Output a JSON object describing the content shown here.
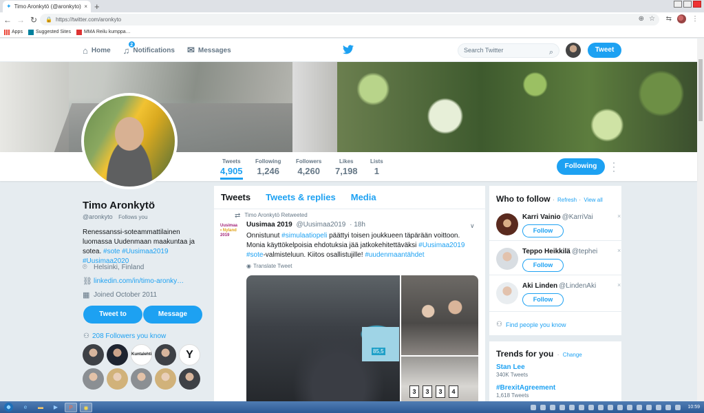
{
  "browser": {
    "tab_title": "Timo Aronkytö (@aronkyto) | Tw…",
    "tab_close": "×",
    "new_tab": "+",
    "url": "https://twitter.com/aronkyto",
    "bookmarks": [
      "Apps",
      "Suggested Sites",
      "MMA Reilu kumppa…"
    ]
  },
  "header": {
    "nav": [
      {
        "label": "Home",
        "icon": "home-icon"
      },
      {
        "label": "Notifications",
        "icon": "bell-icon",
        "badge": "2"
      },
      {
        "label": "Messages",
        "icon": "envelope-icon"
      }
    ],
    "search_placeholder": "Search Twitter",
    "tweet_button": "Tweet"
  },
  "profile": {
    "name": "Timo Aronkytö",
    "handle": "@aronkyto",
    "follows_you": "Follows you",
    "bio_text": "Renessanssi-soteammattilainen luomassa Uudenmaan maakuntaa ja sotea.",
    "bio_tags": [
      "#sote",
      "#Uusimaa2019",
      "#Uusimaa2020"
    ],
    "location": "Helsinki, Finland",
    "website": "linkedin.com/in/timo-aronky…",
    "joined": "Joined October 2011",
    "tweet_to": "Tweet to",
    "message": "Message",
    "followers_you_know": "208 Followers you know",
    "known_logos": {
      "kuntalehti": "Kuntalehti",
      "y_logo": "Y"
    }
  },
  "stats": [
    {
      "label": "Tweets",
      "value": "4,905",
      "active": true
    },
    {
      "label": "Following",
      "value": "1,246"
    },
    {
      "label": "Followers",
      "value": "4,260"
    },
    {
      "label": "Likes",
      "value": "7,198"
    },
    {
      "label": "Lists",
      "value": "1"
    }
  ],
  "following_button": "Following",
  "timeline": {
    "tabs": [
      "Tweets",
      "Tweets & replies",
      "Media"
    ],
    "retweet_label": "Timo Aronkytö Retweeted",
    "tweet": {
      "avatar_lines": [
        "Uusimaa",
        "• Nyland",
        "2019"
      ],
      "author": "Uusimaa 2019",
      "handle": "@Uusimaa2019",
      "time": "· 18h",
      "text_parts": [
        {
          "t": "Onnistunut "
        },
        {
          "t": "#simulaatiopeli",
          "link": true
        },
        {
          "t": " päättyi toisen joukkueen täpärään voittoon.  Monia käyttökelpoisia ehdotuksia jää jatkokehitettäväksi "
        },
        {
          "t": "#Uusimaa2019",
          "link": true
        },
        {
          "t": " "
        },
        {
          "t": "#sote",
          "link": true
        },
        {
          "t": "-valmisteluun. Kiitos osallistujille! "
        },
        {
          "t": "#uudenmaantähdet",
          "link": true
        }
      ],
      "translate": "Translate Tweet",
      "screen_value": "85,5",
      "card_digits": [
        "3",
        "3",
        "3",
        "4"
      ]
    }
  },
  "who_to_follow": {
    "title": "Who to follow",
    "refresh": "Refresh",
    "separator": "·",
    "view_all": "View all",
    "items": [
      {
        "name": "Karri Vainio",
        "handle": "@KarriVai",
        "button": "Follow"
      },
      {
        "name": "Teppo Heikkilä",
        "handle": "@tephei",
        "button": "Follow"
      },
      {
        "name": "Aki Linden",
        "handle": "@LindenAki",
        "button": "Follow"
      }
    ],
    "dismiss": "×",
    "find_people": "Find people you know"
  },
  "trends": {
    "title": "Trends for you",
    "change": "Change",
    "items": [
      {
        "name": "Stan Lee",
        "count": "340K Tweets"
      },
      {
        "name": "#BrexitAgreement",
        "count": "1,618 Tweets"
      }
    ]
  },
  "taskbar": {
    "clock": "10:59"
  }
}
